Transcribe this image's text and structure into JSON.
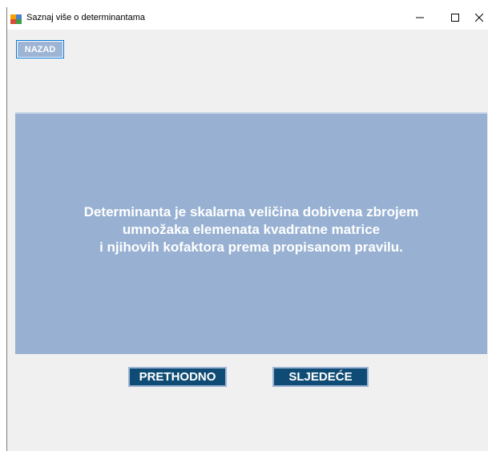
{
  "window": {
    "title": "Saznaj više o determinantama",
    "minimize_glyph": "—",
    "maximize_glyph": "☐",
    "close_glyph": "✕"
  },
  "back_button": {
    "label": "NAZAD"
  },
  "content": {
    "text": "Determinanta je skalarna veličina dobivena zbrojem\numnožaka elemenata kvadratne matrice\ni njihovih kofaktora prema propisanom pravilu."
  },
  "navigation": {
    "previous_label": "PRETHODNO",
    "next_label": "SLJEDEĆE"
  },
  "colors": {
    "panel_background": "#98b1d2",
    "nav_button_background": "#0f4c75",
    "back_button_background": "#9db4d4",
    "accent_border": "#0078d7"
  },
  "icons": {
    "app": "app-window-icon",
    "minimize": "minimize-icon",
    "maximize": "maximize-icon",
    "close": "close-icon"
  }
}
